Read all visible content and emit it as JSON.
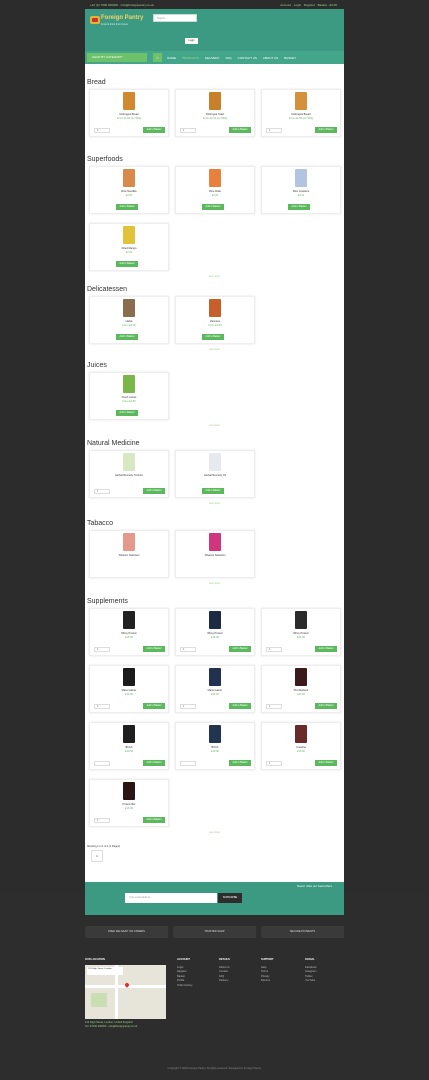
{
  "topbar": {
    "left": "+44 (0) 7000 000000 · info@foreignpantry.co.uk",
    "right": "Account · Login · Register · Basket · £0.00"
  },
  "header": {
    "logo_title": "Foreign Pantry",
    "logo_subtitle": "Food & drink from home",
    "search_placeholder": "Search...",
    "login_label": "Login"
  },
  "nav": {
    "categories_label": "SHOP BY CATEGORY",
    "home_icon": "home-icon",
    "links": [
      "HOME",
      "PRODUCTS",
      "DELIVERY",
      "FAQ",
      "CONTACT US",
      "ABOUT US",
      "BASKET"
    ]
  },
  "sections": [
    {
      "title": "Bread",
      "see_more": "",
      "products": [
        {
          "name": "Dobrogea Bread",
          "price": "From £1.80 per 500g",
          "qty": "1",
          "button": "Add to Basket",
          "color": "#d0892e"
        },
        {
          "name": "Dobrogea Toast",
          "price": "From £2.10 per 500g",
          "qty": "1",
          "button": "Add to Basket",
          "color": "#c9802b"
        },
        {
          "name": "Dobrogea Bread",
          "price": "From £1.80 per 500g",
          "qty": "1",
          "button": "Add to Basket",
          "color": "#d4903a"
        }
      ]
    },
    {
      "title": "Superfoods",
      "see_more": "see more",
      "products": [
        {
          "name": "Rice Noodles",
          "price": "£2.00",
          "button": "Add to Basket",
          "color": "#d9894a"
        },
        {
          "name": "Rice Rolls",
          "price": "£2.00",
          "button": "Add to Basket",
          "color": "#e8813b"
        },
        {
          "name": "Rice Crackers",
          "price": "£2.00",
          "button": "Add to Basket",
          "color": "#b3c4e0"
        },
        {
          "name": "Dried Mango",
          "price": "£2.00",
          "button": "Add to Basket",
          "color": "#e2c23a"
        }
      ]
    },
    {
      "title": "Delicatessen",
      "see_more": "see more",
      "products": [
        {
          "name": "Halva",
          "price": "From £3.00",
          "button": "Add to Basket",
          "color": "#8a6d4f"
        },
        {
          "name": "Zacusca",
          "price": "From £3.00",
          "button": "Add to Basket",
          "color": "#c75f2a"
        }
      ]
    },
    {
      "title": "Juices",
      "see_more": "see more",
      "products": [
        {
          "name": "Fresh Juices",
          "price": "From £2.50",
          "button": "Add to Basket",
          "color": "#7ab648"
        }
      ]
    },
    {
      "title": "Natural Medicine",
      "see_more": "see more",
      "products": [
        {
          "name": "Herbal Remedy Tincture",
          "price": "",
          "qty": "1",
          "button": "Add to Basket",
          "color": "#d8e8c2"
        },
        {
          "name": "Herbal Remedy Oil",
          "price": "",
          "button": "Add to Basket",
          "color": "#e6e9ee"
        }
      ]
    },
    {
      "title": "Tabacco",
      "see_more": "see more",
      "products": [
        {
          "name": "Tobacco Selection",
          "price": "",
          "button": "",
          "color": "#e39a8a"
        },
        {
          "name": "Tobacco Selection",
          "price": "",
          "button": "",
          "color": "#d1357d"
        }
      ]
    },
    {
      "title": "Supplements",
      "see_more": "see more",
      "products": [
        {
          "name": "Whey Protein",
          "price": "£25.00",
          "qty": "1",
          "button": "Add to Basket",
          "color": "#222"
        },
        {
          "name": "Whey Protein",
          "price": "£25.00",
          "qty": "1",
          "button": "Add to Basket",
          "color": "#1d2a44"
        },
        {
          "name": "Whey Protein",
          "price": "£25.00",
          "qty": "1",
          "button": "Add to Basket",
          "color": "#2b2b2b"
        },
        {
          "name": "Mass Gainer",
          "price": "£30.00",
          "qty": "1",
          "button": "Add to Basket",
          "color": "#1b1b1b"
        },
        {
          "name": "Mass Gainer",
          "price": "£30.00",
          "qty": "1",
          "button": "Add to Basket",
          "color": "#21314f"
        },
        {
          "name": "Pre-Workout",
          "price": "£20.00",
          "qty": "1",
          "button": "Add to Basket",
          "color": "#3a1a1a"
        },
        {
          "name": "BCAA",
          "price": "£20.00",
          "qty": "",
          "button": "Add to Basket",
          "color": "#1f1f1f"
        },
        {
          "name": "BCAA",
          "price": "£20.00",
          "qty": "",
          "button": "Add to Basket",
          "color": "#22344f"
        },
        {
          "name": "Creatine",
          "price": "£15.00",
          "qty": "1",
          "button": "Add to Basket",
          "color": "#6a2a2a"
        },
        {
          "name": "Protein Bar",
          "price": "£15.00",
          "qty": "1",
          "button": "Add to Basket",
          "color": "#2a1414"
        }
      ]
    }
  ],
  "pagination": {
    "info": "Showing 1 to 1 of 1 (1 Pages)",
    "current": "1"
  },
  "footer": {
    "newsletter_placeholder": "Your email address",
    "newsletter_button": "SUBSCRIBE",
    "newsletter_text": "Never miss our best offers",
    "buttons": [
      "FREE DELIVERY ON ORDERS",
      "TRUSTED SHOP",
      "SECURE PAYMENTS"
    ],
    "map_title": "OUR LOCATION",
    "map_address": "123 High Street, London",
    "map_meta": [
      "123 High Street, London, United Kingdom",
      "Tel: 07000 000000 · info@foreignpantry.co.uk"
    ],
    "columns": [
      {
        "title": "ACCOUNT",
        "items": [
          "Login",
          "Register",
          "Basket",
          "Profile",
          "Order History"
        ]
      },
      {
        "title": "DETAILS",
        "items": [
          "About Us",
          "Contact",
          "FAQ",
          "Delivery"
        ]
      },
      {
        "title": "SUPPORT",
        "items": [
          "Help",
          "Terms",
          "Privacy",
          "Returns"
        ]
      },
      {
        "title": "SOCIAL",
        "items": [
          "Facebook",
          "Instagram",
          "Twitter",
          "YouTube"
        ]
      }
    ],
    "copyright": "Copyright © 2024 Foreign Pantry. All rights reserved. Designed by Foreign Pantry."
  }
}
